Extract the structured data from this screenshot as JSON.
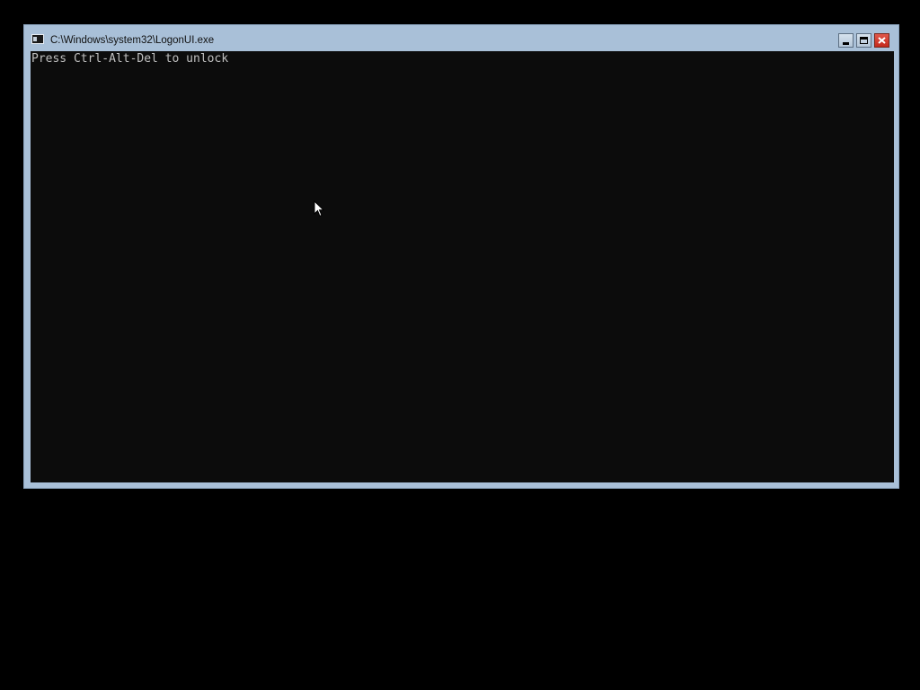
{
  "window": {
    "title": "C:\\Windows\\system32\\LogonUI.exe",
    "icon": "console-app-icon",
    "controls": {
      "minimize": "minimize-icon",
      "maximize": "maximize-icon",
      "close": "close-icon"
    }
  },
  "console": {
    "lines": [
      "Press Ctrl-Alt-Del to unlock"
    ]
  },
  "colors": {
    "desktop": "#000000",
    "window_frame": "#a9c0d8",
    "console_background": "#0c0c0c",
    "console_text": "#c0c0c0",
    "close_button": "#c4291c"
  }
}
